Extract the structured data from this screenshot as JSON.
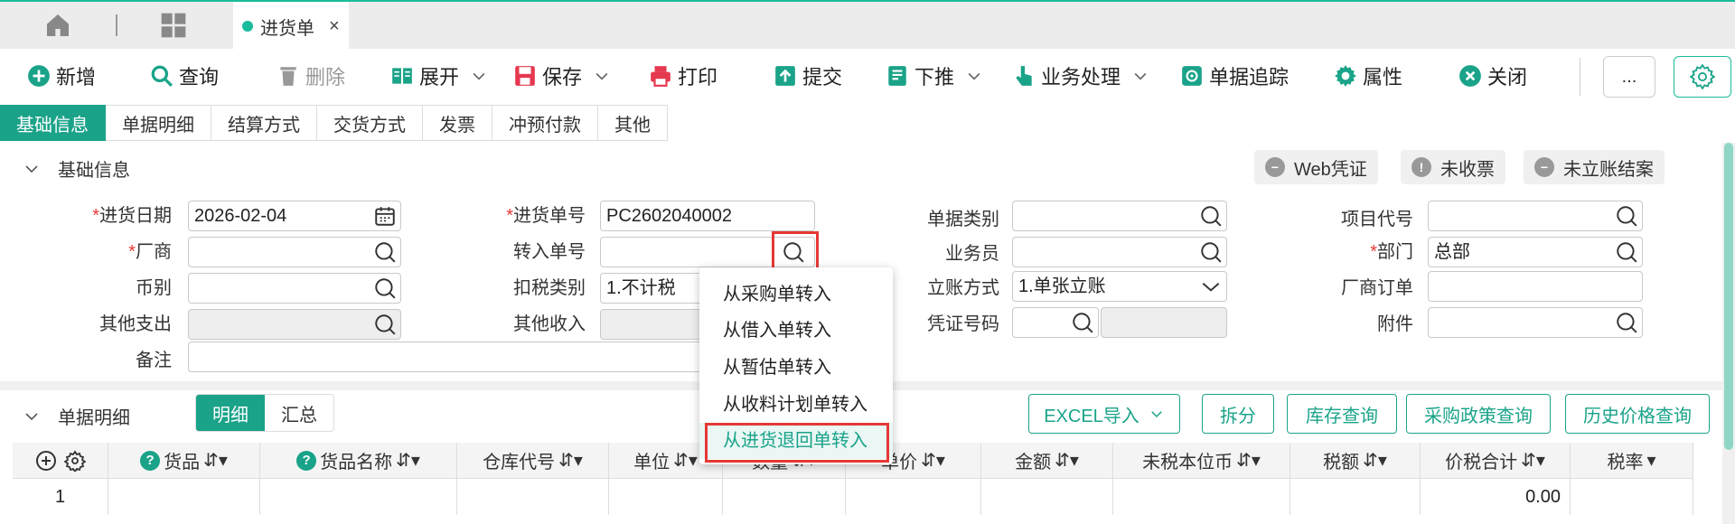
{
  "topbar": {
    "icons": [
      "home-icon",
      "grid-icon"
    ],
    "doc_tab": {
      "label": "进货单",
      "close": "×"
    }
  },
  "toolbar": {
    "items": [
      {
        "name": "new",
        "label": "新增",
        "icon": "plus-circle-icon"
      },
      {
        "name": "query",
        "label": "查询",
        "icon": "search-icon"
      },
      {
        "name": "delete",
        "label": "删除",
        "icon": "trash-icon",
        "disabled": true
      },
      {
        "name": "expand",
        "label": "展开",
        "icon": "book-icon",
        "dropdown": true
      },
      {
        "name": "save",
        "label": "保存",
        "icon": "save-icon",
        "dropdown": true
      },
      {
        "name": "print",
        "label": "打印",
        "icon": "printer-icon"
      },
      {
        "name": "submit",
        "label": "提交",
        "icon": "upload-icon"
      },
      {
        "name": "push-down",
        "label": "下推",
        "icon": "list-icon",
        "dropdown": true
      },
      {
        "name": "business",
        "label": "业务处理",
        "icon": "hand-icon",
        "dropdown": true
      },
      {
        "name": "trace",
        "label": "单据追踪",
        "icon": "target-icon"
      },
      {
        "name": "props",
        "label": "属性",
        "icon": "gear-icon"
      },
      {
        "name": "close",
        "label": "关闭",
        "icon": "close-circle-icon"
      }
    ],
    "more_label": "..."
  },
  "section_tabs": [
    "基础信息",
    "单据明细",
    "结算方式",
    "交货方式",
    "发票",
    "冲预付款",
    "其他"
  ],
  "basic": {
    "title": "基础信息",
    "tags": [
      "Web凭证",
      "未收票",
      "未立账结案"
    ],
    "fields": {
      "date_label": "进货日期",
      "date_value": "2026-02-04",
      "vendor_label": "厂商",
      "currency_label": "币别",
      "other_exp_label": "其他支出",
      "remark_label": "备注",
      "no_label": "进货单号",
      "no_value": "PC2602040002",
      "transfer_label": "转入单号",
      "tax_label": "扣税类别",
      "tax_value": "1.不计税",
      "other_inc_label": "其他收入",
      "doctype_label": "单据类别",
      "staff_label": "业务员",
      "account_label": "立账方式",
      "account_value": "1.单张立账",
      "voucher_label": "凭证号码",
      "project_label": "项目代号",
      "dept_label": "部门",
      "dept_value": "总部",
      "vendor_order_label": "厂商订单",
      "attach_label": "附件"
    }
  },
  "dropdown": {
    "items": [
      "从采购单转入",
      "从借入单转入",
      "从暂估单转入",
      "从收料计划单转入",
      "从进货退回单转入"
    ],
    "selected_index": 4
  },
  "detail": {
    "title": "单据明细",
    "toggle": [
      "明细",
      "汇总"
    ],
    "buttons": [
      "EXCEL导入",
      "拆分",
      "库存查询",
      "采购政策查询",
      "历史价格查询"
    ],
    "columns": [
      "货品",
      "货品名称",
      "仓库代号",
      "单位",
      "数量",
      "单价",
      "金额",
      "未税本位币",
      "税额",
      "价税合计",
      "税率"
    ],
    "rows": [
      {
        "index": "1",
        "total": "0.00"
      }
    ]
  }
}
